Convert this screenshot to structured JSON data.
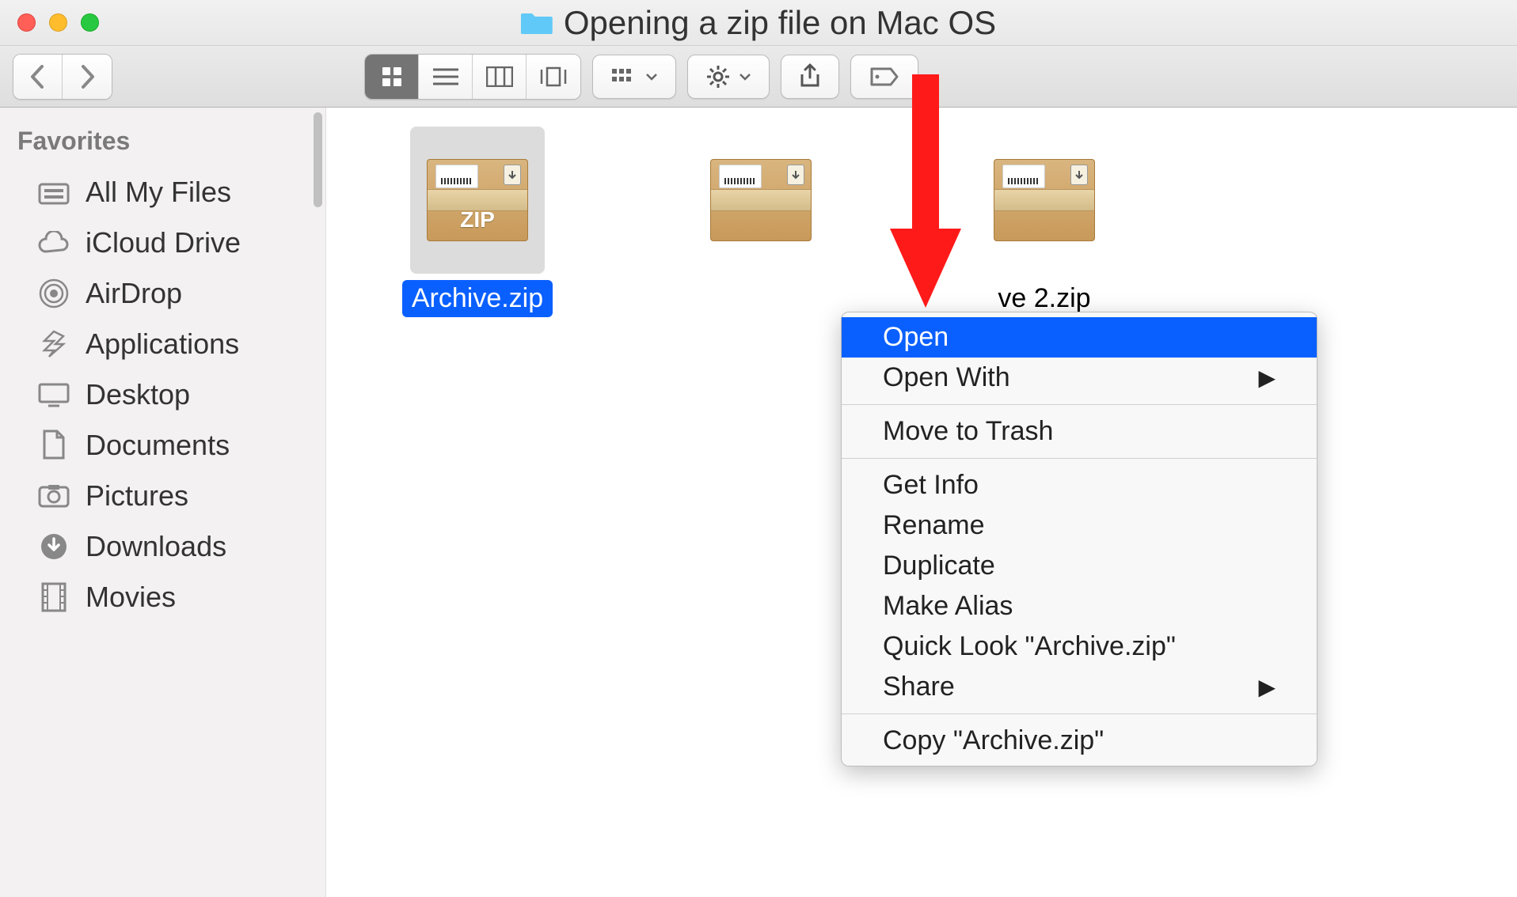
{
  "window": {
    "title": "Opening a zip file on Mac OS"
  },
  "sidebar": {
    "heading": "Favorites",
    "items": [
      {
        "label": "All My Files",
        "icon": "all-files"
      },
      {
        "label": "iCloud Drive",
        "icon": "cloud"
      },
      {
        "label": "AirDrop",
        "icon": "airdrop"
      },
      {
        "label": "Applications",
        "icon": "applications"
      },
      {
        "label": "Desktop",
        "icon": "desktop"
      },
      {
        "label": "Documents",
        "icon": "documents"
      },
      {
        "label": "Pictures",
        "icon": "pictures"
      },
      {
        "label": "Downloads",
        "icon": "downloads"
      },
      {
        "label": "Movies",
        "icon": "movies"
      }
    ]
  },
  "files": [
    {
      "label": "Archive.zip",
      "selected": true
    },
    {
      "label": "",
      "selected": false
    },
    {
      "label": "ve 2.zip",
      "selected": false
    }
  ],
  "zipBadge": "ZIP",
  "contextMenu": {
    "items": [
      {
        "label": "Open",
        "highlighted": true,
        "submenu": false,
        "divider": false
      },
      {
        "label": "Open With",
        "highlighted": false,
        "submenu": true,
        "divider": false
      },
      {
        "divider": true
      },
      {
        "label": "Move to Trash",
        "highlighted": false,
        "submenu": false,
        "divider": false
      },
      {
        "divider": true
      },
      {
        "label": "Get Info",
        "highlighted": false,
        "submenu": false,
        "divider": false
      },
      {
        "label": "Rename",
        "highlighted": false,
        "submenu": false,
        "divider": false
      },
      {
        "label": "Duplicate",
        "highlighted": false,
        "submenu": false,
        "divider": false
      },
      {
        "label": "Make Alias",
        "highlighted": false,
        "submenu": false,
        "divider": false
      },
      {
        "label": "Quick Look \"Archive.zip\"",
        "highlighted": false,
        "submenu": false,
        "divider": false
      },
      {
        "label": "Share",
        "highlighted": false,
        "submenu": true,
        "divider": false
      },
      {
        "divider": true
      },
      {
        "label": "Copy \"Archive.zip\"",
        "highlighted": false,
        "submenu": false,
        "divider": false
      }
    ]
  }
}
